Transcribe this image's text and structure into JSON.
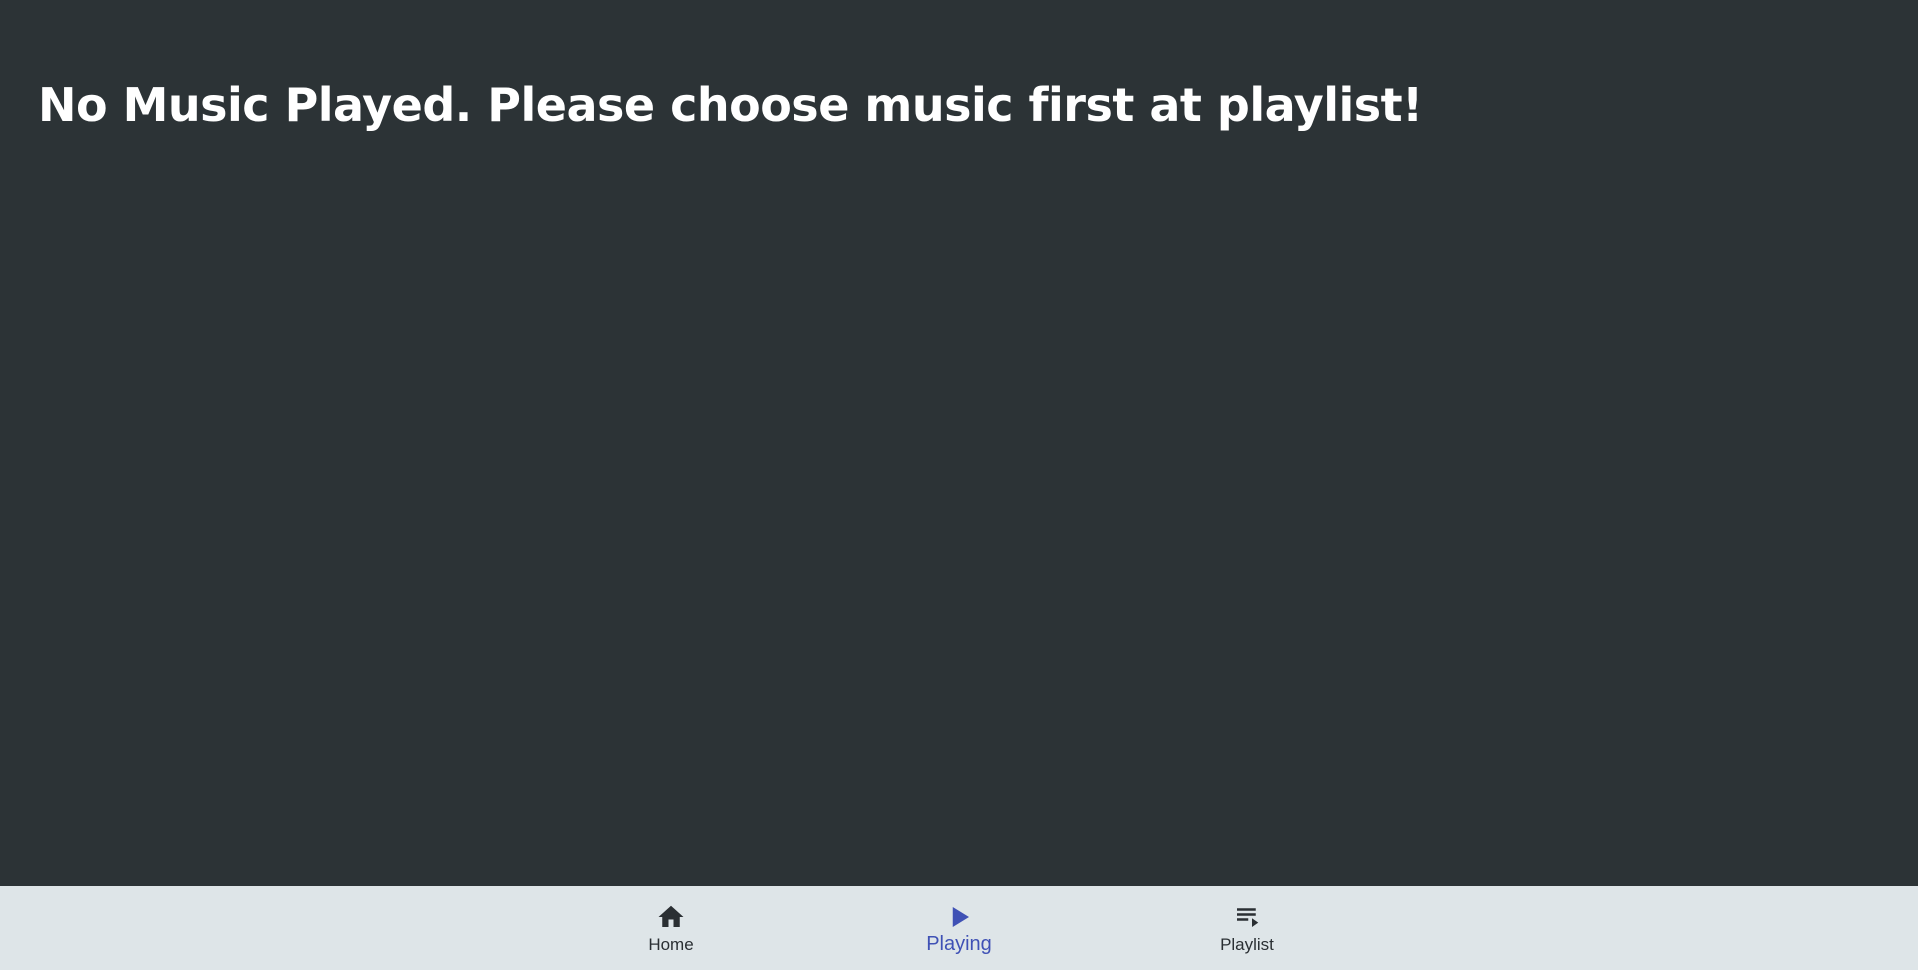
{
  "main": {
    "message": "No Music Played. Please choose music first at playlist!"
  },
  "bottom_nav": {
    "items": [
      {
        "label": "Home",
        "icon": "home-icon",
        "active": false
      },
      {
        "label": "Playing",
        "icon": "play-icon",
        "active": true
      },
      {
        "label": "Playlist",
        "icon": "playlist-play-icon",
        "active": false
      }
    ]
  },
  "colors": {
    "background": "#2c3336",
    "nav_background": "#dee5e8",
    "active": "#3f51b5",
    "inactive": "#2a2f33",
    "text": "#ffffff"
  }
}
